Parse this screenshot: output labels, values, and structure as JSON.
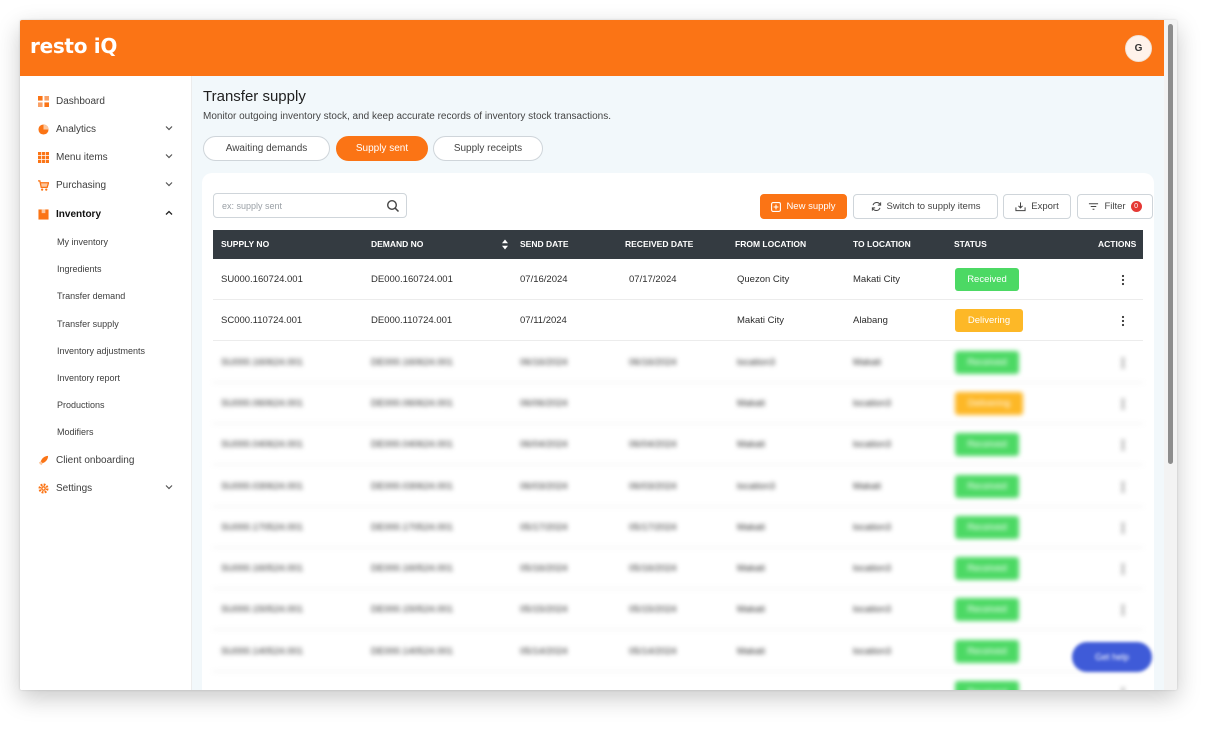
{
  "app": {
    "logo": "resto iQ",
    "avatar_initial": "G"
  },
  "sidebar": {
    "items": [
      {
        "label": "Dashboard",
        "icon": "dashboard-icon",
        "chevron": false
      },
      {
        "label": "Analytics",
        "icon": "pie-chart-icon",
        "chevron": true
      },
      {
        "label": "Menu items",
        "icon": "grid-icon",
        "chevron": true
      },
      {
        "label": "Purchasing",
        "icon": "cart-icon",
        "chevron": true
      },
      {
        "label": "Inventory",
        "icon": "box-icon",
        "chevron": true,
        "expanded": true
      },
      {
        "label": "Client onboarding",
        "icon": "rocket-icon",
        "chevron": false
      },
      {
        "label": "Settings",
        "icon": "gear-icon",
        "chevron": true
      }
    ],
    "inventory_sub": [
      "My inventory",
      "Ingredients",
      "Transfer demand",
      "Transfer supply",
      "Inventory adjustments",
      "Inventory report",
      "Productions",
      "Modifiers"
    ]
  },
  "page": {
    "title": "Transfer supply",
    "subtitle": "Monitor outgoing inventory stock, and keep accurate records of inventory stock transactions."
  },
  "tabs": [
    {
      "label": "Awaiting demands",
      "active": false
    },
    {
      "label": "Supply sent",
      "active": true
    },
    {
      "label": "Supply receipts",
      "active": false
    }
  ],
  "toolbar": {
    "search_placeholder": "ex: supply sent",
    "new_supply": "New supply",
    "switch": "Switch to supply items",
    "export": "Export",
    "filter": "Filter",
    "filter_count": "0"
  },
  "table": {
    "headers": [
      "SUPPLY NO",
      "DEMAND NO",
      "SEND DATE",
      "RECEIVED DATE",
      "FROM LOCATION",
      "TO LOCATION",
      "STATUS",
      "ACTIONS"
    ],
    "rows": [
      {
        "supply_no": "SU000.160724.001",
        "demand_no": "DE000.160724.001",
        "send_date": "07/16/2024",
        "received_date": "07/17/2024",
        "from": "Quezon City",
        "to": "Makati City",
        "status": "Received"
      },
      {
        "supply_no": "SC000.110724.001",
        "demand_no": "DE000.110724.001",
        "send_date": "07/11/2024",
        "received_date": "",
        "from": "Makati City",
        "to": "Alabang",
        "status": "Delivering"
      }
    ],
    "blurred_rows": [
      {
        "supply_no": "SU000.160624.001",
        "demand_no": "DE000.160624.001",
        "send_date": "06/16/2024",
        "received_date": "06/16/2024",
        "from": "location3",
        "to": "Makati",
        "status": "Received"
      },
      {
        "supply_no": "SU000.060624.001",
        "demand_no": "DE000.060624.001",
        "send_date": "06/06/2024",
        "received_date": "",
        "from": "Makati",
        "to": "location3",
        "status": "Delivering"
      },
      {
        "supply_no": "SU000.040624.001",
        "demand_no": "DE000.040624.001",
        "send_date": "06/04/2024",
        "received_date": "06/04/2024",
        "from": "Makati",
        "to": "location3",
        "status": "Received"
      },
      {
        "supply_no": "SU000.030624.001",
        "demand_no": "DE000.030624.001",
        "send_date": "06/03/2024",
        "received_date": "06/03/2024",
        "from": "location3",
        "to": "Makati",
        "status": "Received"
      },
      {
        "supply_no": "SU000.170524.001",
        "demand_no": "DE000.170524.001",
        "send_date": "05/17/2024",
        "received_date": "05/17/2024",
        "from": "Makati",
        "to": "location3",
        "status": "Received"
      },
      {
        "supply_no": "SU000.160524.001",
        "demand_no": "DE000.160524.001",
        "send_date": "05/16/2024",
        "received_date": "05/16/2024",
        "from": "Makati",
        "to": "location3",
        "status": "Received"
      },
      {
        "supply_no": "SU000.150524.001",
        "demand_no": "DE000.150524.001",
        "send_date": "05/15/2024",
        "received_date": "05/15/2024",
        "from": "Makati",
        "to": "location3",
        "status": "Received"
      },
      {
        "supply_no": "SU000.140524.001",
        "demand_no": "DE000.140524.001",
        "send_date": "05/14/2024",
        "received_date": "05/14/2024",
        "from": "Makati",
        "to": "location3",
        "status": "Received"
      },
      {
        "supply_no": "",
        "demand_no": "",
        "send_date": "",
        "received_date": "",
        "from": "",
        "to": "",
        "status": "Received"
      }
    ]
  },
  "help": {
    "label": "Get help"
  },
  "colors": {
    "brand": "#fb7415",
    "received": "#4cd964",
    "delivering": "#fdb827",
    "header": "#343b41"
  }
}
